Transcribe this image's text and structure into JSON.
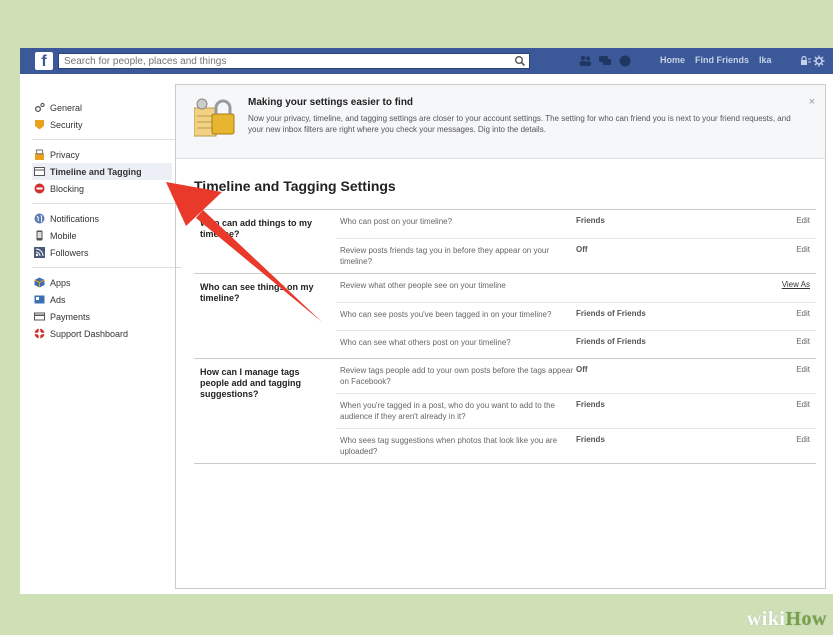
{
  "topbar": {
    "search_placeholder": "Search for people, places and things",
    "links": [
      "Home",
      "Find Friends",
      "Ika"
    ]
  },
  "sidebar": {
    "groups": [
      [
        {
          "label": "General",
          "icon": "gear-icon"
        },
        {
          "label": "Security",
          "icon": "shield-icon"
        }
      ],
      [
        {
          "label": "Privacy",
          "icon": "lock-icon"
        },
        {
          "label": "Timeline and Tagging",
          "icon": "timeline-icon",
          "active": true
        },
        {
          "label": "Blocking",
          "icon": "block-icon"
        }
      ],
      [
        {
          "label": "Notifications",
          "icon": "globe-icon"
        },
        {
          "label": "Mobile",
          "icon": "phone-icon"
        },
        {
          "label": "Followers",
          "icon": "rss-icon"
        }
      ],
      [
        {
          "label": "Apps",
          "icon": "cube-icon"
        },
        {
          "label": "Ads",
          "icon": "ads-icon"
        },
        {
          "label": "Payments",
          "icon": "card-icon"
        },
        {
          "label": "Support Dashboard",
          "icon": "lifebuoy-icon"
        }
      ]
    ]
  },
  "notice": {
    "title": "Making your settings easier to find",
    "text": "Now your privacy, timeline, and tagging settings are closer to your account settings. The setting for who can friend you is next to your friend requests, and your new inbox filters are right where you check your messages. Dig into the details.",
    "close": "×"
  },
  "settings": {
    "title": "Timeline and Tagging Settings",
    "sections": [
      {
        "heading": "Who can add things to my timeline?",
        "rows": [
          {
            "q": "Who can post on your timeline?",
            "v": "Friends",
            "a": "Edit"
          },
          {
            "q": "Review posts friends tag you in before they appear on your timeline?",
            "v": "Off",
            "a": "Edit"
          }
        ]
      },
      {
        "heading": "Who can see things on my timeline?",
        "rows": [
          {
            "q": "Review what other people see on your timeline",
            "v": "",
            "a": "View As"
          },
          {
            "q": "Who can see posts you've been tagged in on your timeline?",
            "v": "Friends of Friends",
            "a": "Edit"
          },
          {
            "q": "Who can see what others post on your timeline?",
            "v": "Friends of Friends",
            "a": "Edit"
          }
        ]
      },
      {
        "heading": "How can I manage tags people add and tagging suggestions?",
        "rows": [
          {
            "q": "Review tags people add to your own posts before the tags appear on Facebook?",
            "v": "Off",
            "a": "Edit"
          },
          {
            "q": "When you're tagged in a post, who do you want to add to the audience if they aren't already in it?",
            "v": "Friends",
            "a": "Edit"
          },
          {
            "q": "Who sees tag suggestions when photos that look like you are uploaded?",
            "v": "Friends",
            "a": "Edit"
          }
        ]
      }
    ]
  },
  "watermark": {
    "part1": "wiki",
    "part2": "How"
  },
  "colors": {
    "brand": "#3b5998",
    "arrow": "#e8392b",
    "background": "#cfe0b6"
  }
}
